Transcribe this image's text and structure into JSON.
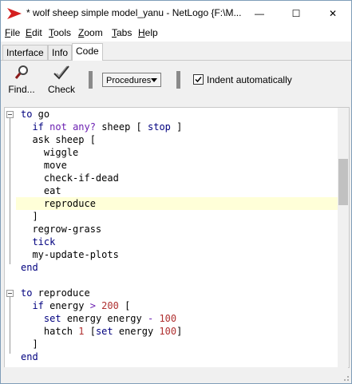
{
  "window": {
    "title": "* wolf sheep simple model_yanu - NetLogo {F:\\M...",
    "minimize_glyph": "—",
    "maximize_glyph": "☐",
    "close_glyph": "✕"
  },
  "menubar": {
    "items": [
      {
        "key": "F",
        "rest": "ile"
      },
      {
        "key": "E",
        "rest": "dit"
      },
      {
        "key": "T",
        "rest": "ools"
      },
      {
        "key": "Z",
        "rest": "oom"
      },
      {
        "key": "T",
        "rest": "abs"
      },
      {
        "key": "H",
        "rest": "elp"
      }
    ]
  },
  "tabs": [
    "Interface",
    "Info",
    "Code"
  ],
  "active_tab": "Code",
  "toolbar": {
    "find_label": "Find...",
    "check_label": "Check",
    "procedures_label": "Procedures",
    "indent_label": "Indent automatically",
    "indent_checked": true
  },
  "code": {
    "highlighted_line": 7,
    "lines": [
      [
        [
          "kw",
          "to"
        ],
        [
          "t",
          " go"
        ]
      ],
      [
        [
          "t",
          "  "
        ],
        [
          "kw",
          "if"
        ],
        [
          "t",
          " "
        ],
        [
          "prim",
          "not"
        ],
        [
          "t",
          " "
        ],
        [
          "prim",
          "any?"
        ],
        [
          "t",
          " sheep [ "
        ],
        [
          "kw",
          "stop"
        ],
        [
          "t",
          " ]"
        ]
      ],
      [
        [
          "t",
          "  ask sheep ["
        ]
      ],
      [
        [
          "t",
          "    wiggle"
        ]
      ],
      [
        [
          "t",
          "    move"
        ]
      ],
      [
        [
          "t",
          "    check-if-dead"
        ]
      ],
      [
        [
          "t",
          "    eat"
        ]
      ],
      [
        [
          "t",
          "    reproduce"
        ]
      ],
      [
        [
          "t",
          "  ]"
        ]
      ],
      [
        [
          "t",
          "  regrow-grass"
        ]
      ],
      [
        [
          "t",
          "  "
        ],
        [
          "kw",
          "tick"
        ]
      ],
      [
        [
          "t",
          "  my-update-plots"
        ]
      ],
      [
        [
          "kw",
          "end"
        ]
      ],
      [
        [
          "t",
          ""
        ]
      ],
      [
        [
          "kw",
          "to"
        ],
        [
          "t",
          " reproduce"
        ]
      ],
      [
        [
          "t",
          "  "
        ],
        [
          "kw",
          "if"
        ],
        [
          "t",
          " energy "
        ],
        [
          "prim",
          ">"
        ],
        [
          "t",
          " "
        ],
        [
          "num",
          "200"
        ],
        [
          "t",
          " ["
        ]
      ],
      [
        [
          "t",
          "    "
        ],
        [
          "kw",
          "set"
        ],
        [
          "t",
          " energy energy "
        ],
        [
          "prim",
          "-"
        ],
        [
          "t",
          " "
        ],
        [
          "num",
          "100"
        ]
      ],
      [
        [
          "t",
          "    hatch "
        ],
        [
          "num",
          "1"
        ],
        [
          "t",
          " ["
        ],
        [
          "kw",
          "set"
        ],
        [
          "t",
          " energy "
        ],
        [
          "num",
          "100"
        ],
        [
          "t",
          "]"
        ]
      ],
      [
        [
          "t",
          "  ]"
        ]
      ],
      [
        [
          "kw",
          "end"
        ]
      ]
    ]
  },
  "colors": {
    "keyword": "#00007f",
    "primitive": "#6a1eb1",
    "number": "#b03030",
    "highlight": "#ffffd8"
  }
}
